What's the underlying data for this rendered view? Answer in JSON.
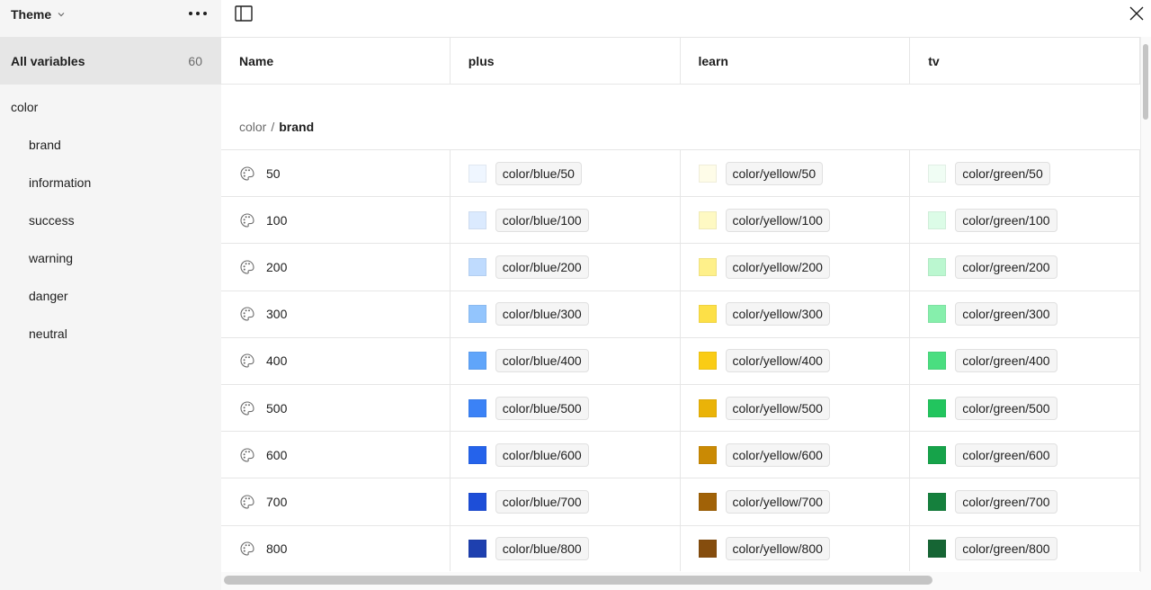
{
  "sidebar": {
    "theme_label": "Theme",
    "all_variables": {
      "label": "All variables",
      "count": "60"
    },
    "groups": [
      {
        "label": "color",
        "level": 0
      },
      {
        "label": "brand",
        "level": 1
      },
      {
        "label": "information",
        "level": 1
      },
      {
        "label": "success",
        "level": 1
      },
      {
        "label": "warning",
        "level": 1
      },
      {
        "label": "danger",
        "level": 1
      },
      {
        "label": "neutral",
        "level": 1
      }
    ]
  },
  "table": {
    "headers": {
      "name": "Name",
      "modes": [
        "plus",
        "learn",
        "tv"
      ]
    },
    "group_header": {
      "parent": "color",
      "separator": "/",
      "current": "brand"
    },
    "rows": [
      {
        "name": "50",
        "values": [
          {
            "label": "color/blue/50",
            "color": "#eff6ff"
          },
          {
            "label": "color/yellow/50",
            "color": "#fefce8"
          },
          {
            "label": "color/green/50",
            "color": "#f0fdf4"
          }
        ]
      },
      {
        "name": "100",
        "values": [
          {
            "label": "color/blue/100",
            "color": "#dbeafe"
          },
          {
            "label": "color/yellow/100",
            "color": "#fef9c3"
          },
          {
            "label": "color/green/100",
            "color": "#dcfce7"
          }
        ]
      },
      {
        "name": "200",
        "values": [
          {
            "label": "color/blue/200",
            "color": "#bfdbfe"
          },
          {
            "label": "color/yellow/200",
            "color": "#fef08a"
          },
          {
            "label": "color/green/200",
            "color": "#bbf7d0"
          }
        ]
      },
      {
        "name": "300",
        "values": [
          {
            "label": "color/blue/300",
            "color": "#93c5fd"
          },
          {
            "label": "color/yellow/300",
            "color": "#fde047"
          },
          {
            "label": "color/green/300",
            "color": "#86efac"
          }
        ]
      },
      {
        "name": "400",
        "values": [
          {
            "label": "color/blue/400",
            "color": "#60a5fa"
          },
          {
            "label": "color/yellow/400",
            "color": "#facc15"
          },
          {
            "label": "color/green/400",
            "color": "#4ade80"
          }
        ]
      },
      {
        "name": "500",
        "values": [
          {
            "label": "color/blue/500",
            "color": "#3b82f6"
          },
          {
            "label": "color/yellow/500",
            "color": "#eab308"
          },
          {
            "label": "color/green/500",
            "color": "#22c55e"
          }
        ]
      },
      {
        "name": "600",
        "values": [
          {
            "label": "color/blue/600",
            "color": "#2563eb"
          },
          {
            "label": "color/yellow/600",
            "color": "#ca8a04"
          },
          {
            "label": "color/green/600",
            "color": "#16a34a"
          }
        ]
      },
      {
        "name": "700",
        "values": [
          {
            "label": "color/blue/700",
            "color": "#1d4ed8"
          },
          {
            "label": "color/yellow/700",
            "color": "#a16207"
          },
          {
            "label": "color/green/700",
            "color": "#15803d"
          }
        ]
      },
      {
        "name": "800",
        "values": [
          {
            "label": "color/blue/800",
            "color": "#1e40af"
          },
          {
            "label": "color/yellow/800",
            "color": "#854d0e"
          },
          {
            "label": "color/green/800",
            "color": "#166534"
          }
        ]
      }
    ]
  },
  "icons": {
    "theme_dropdown": "chevron-down-icon",
    "more": "more-horizontal-icon",
    "sidebar_toggle": "panel-left-icon",
    "close": "close-icon",
    "row_type": "palette-icon"
  }
}
